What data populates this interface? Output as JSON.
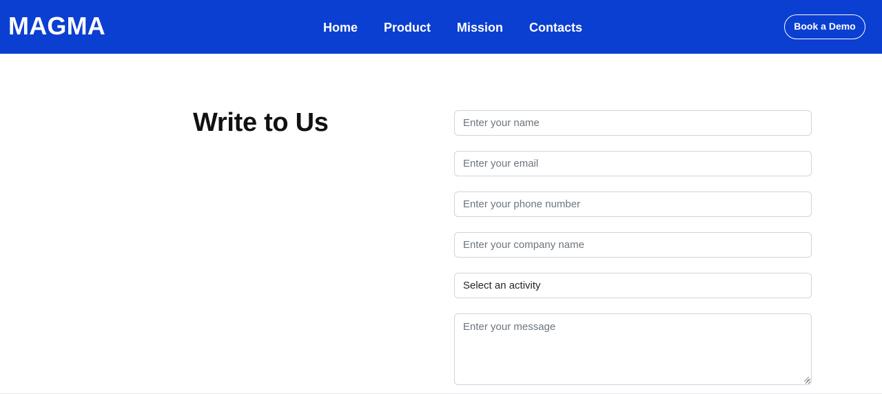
{
  "navbar": {
    "brand": "MAGMA",
    "links": [
      {
        "label": "Home"
      },
      {
        "label": "Product"
      },
      {
        "label": "Mission"
      },
      {
        "label": "Contacts"
      }
    ],
    "cta_label": "Book a Demo",
    "background_color": "#0b3fd1"
  },
  "contact": {
    "heading": "Write to Us",
    "name_placeholder": "Enter your name",
    "email_placeholder": "Enter your email",
    "phone_placeholder": "Enter your phone number",
    "company_placeholder": "Enter your company name",
    "activity_selected": "Select an activity",
    "message_placeholder": "Enter your message"
  }
}
